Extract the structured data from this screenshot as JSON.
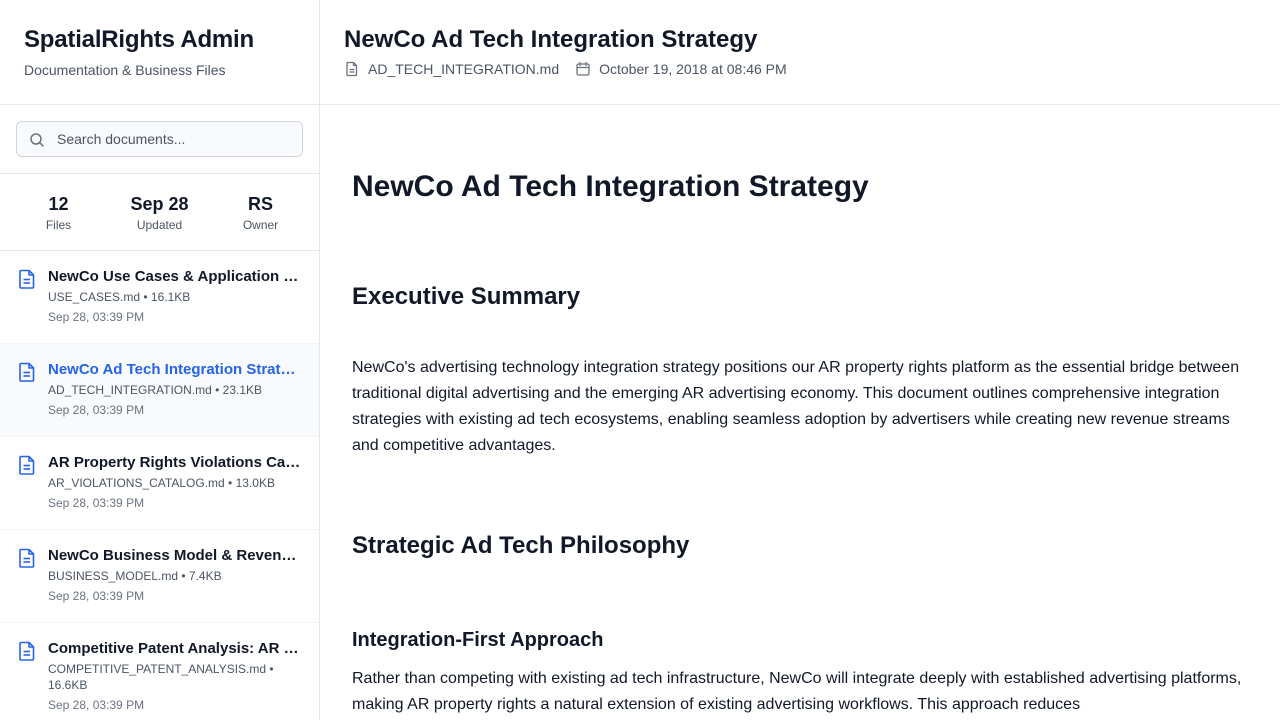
{
  "sidebar": {
    "title": "SpatialRights Admin",
    "subtitle": "Documentation & Business Files",
    "search": {
      "placeholder": "Search documents...",
      "value": ""
    },
    "stats": [
      {
        "value": "12",
        "label": "Files"
      },
      {
        "value": "Sep 28",
        "label": "Updated"
      },
      {
        "value": "RS",
        "label": "Owner"
      }
    ],
    "documents": [
      {
        "title": "NewCo Use Cases & Application Scenarios",
        "meta": "USE_CASES.md • 16.1KB",
        "date": "Sep 28, 03:39 PM"
      },
      {
        "title": "NewCo Ad Tech Integration Strategy",
        "meta": "AD_TECH_INTEGRATION.md • 23.1KB",
        "date": "Sep 28, 03:39 PM"
      },
      {
        "title": "AR Property Rights Violations Catalog",
        "meta": "AR_VIOLATIONS_CATALOG.md • 13.0KB",
        "date": "Sep 28, 03:39 PM"
      },
      {
        "title": "NewCo Business Model & Revenue Streams",
        "meta": "BUSINESS_MODEL.md • 7.4KB",
        "date": "Sep 28, 03:39 PM"
      },
      {
        "title": "Competitive Patent Analysis: AR Property Rights",
        "meta": "COMPETITIVE_PATENT_ANALYSIS.md • 16.6KB",
        "date": "Sep 28, 03:39 PM"
      }
    ]
  },
  "header": {
    "title": "NewCo Ad Tech Integration Strategy",
    "filename": "AD_TECH_INTEGRATION.md",
    "date": "October 19, 2018 at 08:46 PM"
  },
  "content": {
    "h1": "NewCo Ad Tech Integration Strategy",
    "h2_exec": "Executive Summary",
    "p_exec": "NewCo's advertising technology integration strategy positions our AR property rights platform as the essential bridge between traditional digital advertising and the emerging AR advertising economy. This document outlines comprehensive integration strategies with existing ad tech ecosystems, enabling seamless adoption by advertisers while creating new revenue streams and competitive advantages.",
    "h2_phil": "Strategic Ad Tech Philosophy",
    "h3_approach": "Integration-First Approach",
    "p_approach": "Rather than competing with existing ad tech infrastructure, NewCo will integrate deeply with established advertising platforms, making AR property rights a natural extension of existing advertising workflows. This approach reduces"
  },
  "colors": {
    "accent": "#2563eb",
    "text": "#111827",
    "muted": "#4b5563",
    "border": "#e5e7eb"
  },
  "icons": {
    "search": "search-icon",
    "file": "file-icon",
    "calendar": "calendar-icon",
    "document": "document-icon"
  }
}
